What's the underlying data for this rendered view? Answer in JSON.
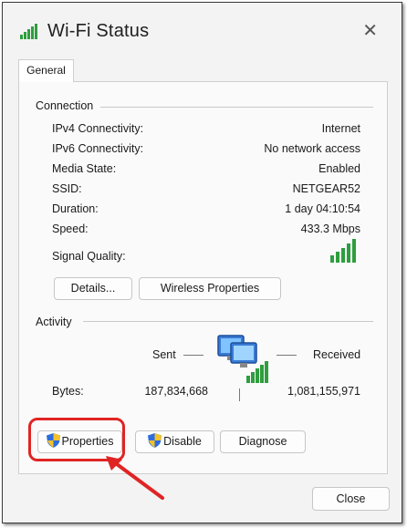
{
  "window": {
    "title": "Wi-Fi Status",
    "close_glyph": "✕",
    "icon": "wifi-signal-icon"
  },
  "tabs": [
    {
      "label": "General"
    }
  ],
  "connection": {
    "heading": "Connection",
    "rows": [
      {
        "label": "IPv4 Connectivity:",
        "value": "Internet"
      },
      {
        "label": "IPv6 Connectivity:",
        "value": "No network access"
      },
      {
        "label": "Media State:",
        "value": "Enabled"
      },
      {
        "label": "SSID:",
        "value": "NETGEAR52"
      },
      {
        "label": "Duration:",
        "value": "1 day 04:10:54"
      },
      {
        "label": "Speed:",
        "value": "433.3 Mbps"
      }
    ],
    "signal_label": "Signal Quality:",
    "signal_icon": "signal-bars-icon",
    "details_button": "Details...",
    "wireless_button": "Wireless Properties"
  },
  "activity": {
    "heading": "Activity",
    "sent_label": "Sent",
    "received_label": "Received",
    "bytes_label": "Bytes:",
    "bytes_sent": "187,834,668",
    "bytes_received": "1,081,155,971",
    "network_icon": "network-computers-icon"
  },
  "buttons": {
    "properties": "Properties",
    "disable": "Disable",
    "diagnose": "Diagnose",
    "close": "Close"
  },
  "colors": {
    "signal_green": "#2e9e3e",
    "highlight_red": "#e02424",
    "shield_blue": "#2d6cdf",
    "shield_yellow": "#f2c22a"
  }
}
